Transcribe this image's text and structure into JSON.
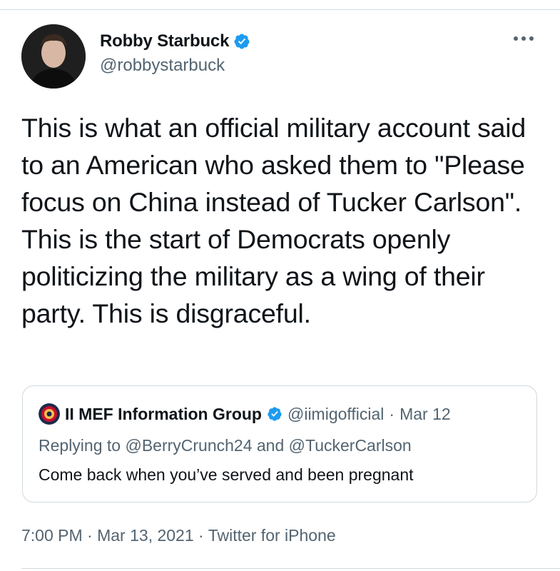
{
  "author": {
    "display_name": "Robby Starbuck",
    "handle": "@robbystarbuck",
    "avatar_icon": "profile-photo",
    "verified_icon": "verified-badge-icon"
  },
  "tweet": {
    "text": "This is what an official military account said to an American who asked them to \"Please focus on China instead of Tucker Carlson\". This is the start of Democrats openly politicizing the military as a wing of their party. This is disgraceful."
  },
  "quote": {
    "display_name": "II MEF Information Group",
    "handle": "@iimigofficial",
    "separator": "·",
    "date": "Mar 12",
    "reply_prefix": "Replying to",
    "reply_to_1": "@BerryCrunch24",
    "reply_and": "and",
    "reply_to_2": "@TuckerCarlson",
    "text": "Come back when you’ve served and been pregnant"
  },
  "meta": {
    "time": "7:00 PM",
    "sep1": "·",
    "date": "Mar 13, 2021",
    "sep2": "·",
    "source": "Twitter for iPhone"
  },
  "colors": {
    "verified_blue": "#1d9bf0",
    "secondary_text": "#536471",
    "border": "#cfd9de"
  }
}
